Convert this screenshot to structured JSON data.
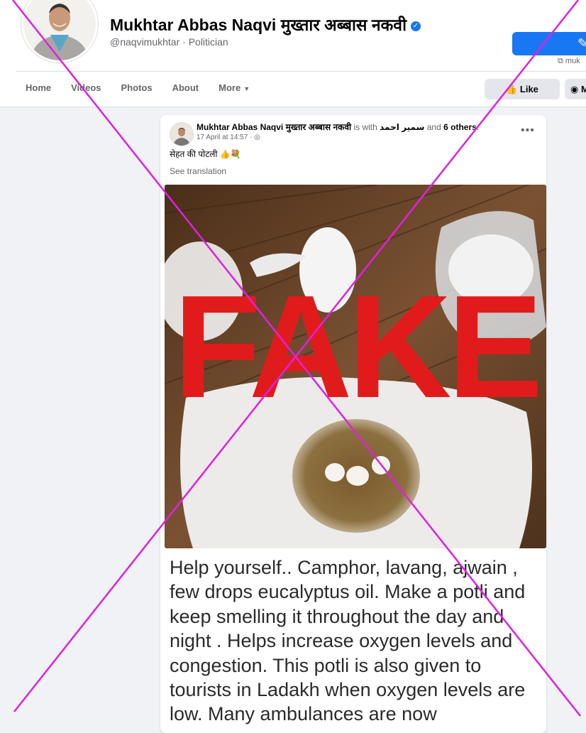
{
  "profile": {
    "name": "Mukhtar Abbas Naqvi मुख्तार अब्बास नकवी",
    "handle": "@naqvimukhtar · Politician",
    "ext_link": "muk",
    "verified_symbol": "✓"
  },
  "nav": {
    "items": [
      "Home",
      "Videos",
      "Photos",
      "About",
      "More"
    ],
    "more_caret": "▼",
    "like": "Like",
    "edit_symbol": "✎",
    "messenger": "M"
  },
  "post": {
    "author": "Mukhtar Abbas Naqvi मुख्तार अब्बास नकवी",
    "with_text": " is with ",
    "with_person": "سمیر احمد",
    "and_text": " and ",
    "others": "6 others",
    "period": ".",
    "date": "17 April at 14:57 · ",
    "globe_symbol": "◎",
    "text": "सेहत की पोटली 👍💐",
    "see_translation": "See translation",
    "dots": "•••",
    "stamp": "FAKE",
    "caption": "Help yourself.. Camphor, lavang, ajwain , few drops eucalyptus oil. Make a potli and keep smelling it throughout the day and night . Helps increase oxygen levels and congestion. This potli is also given to tourists in Ladakh when oxygen levels are low. Many ambulances are now"
  },
  "colors": {
    "accent": "#1877f2",
    "stamp": "#e11b1b",
    "cross": "#e020e0"
  }
}
